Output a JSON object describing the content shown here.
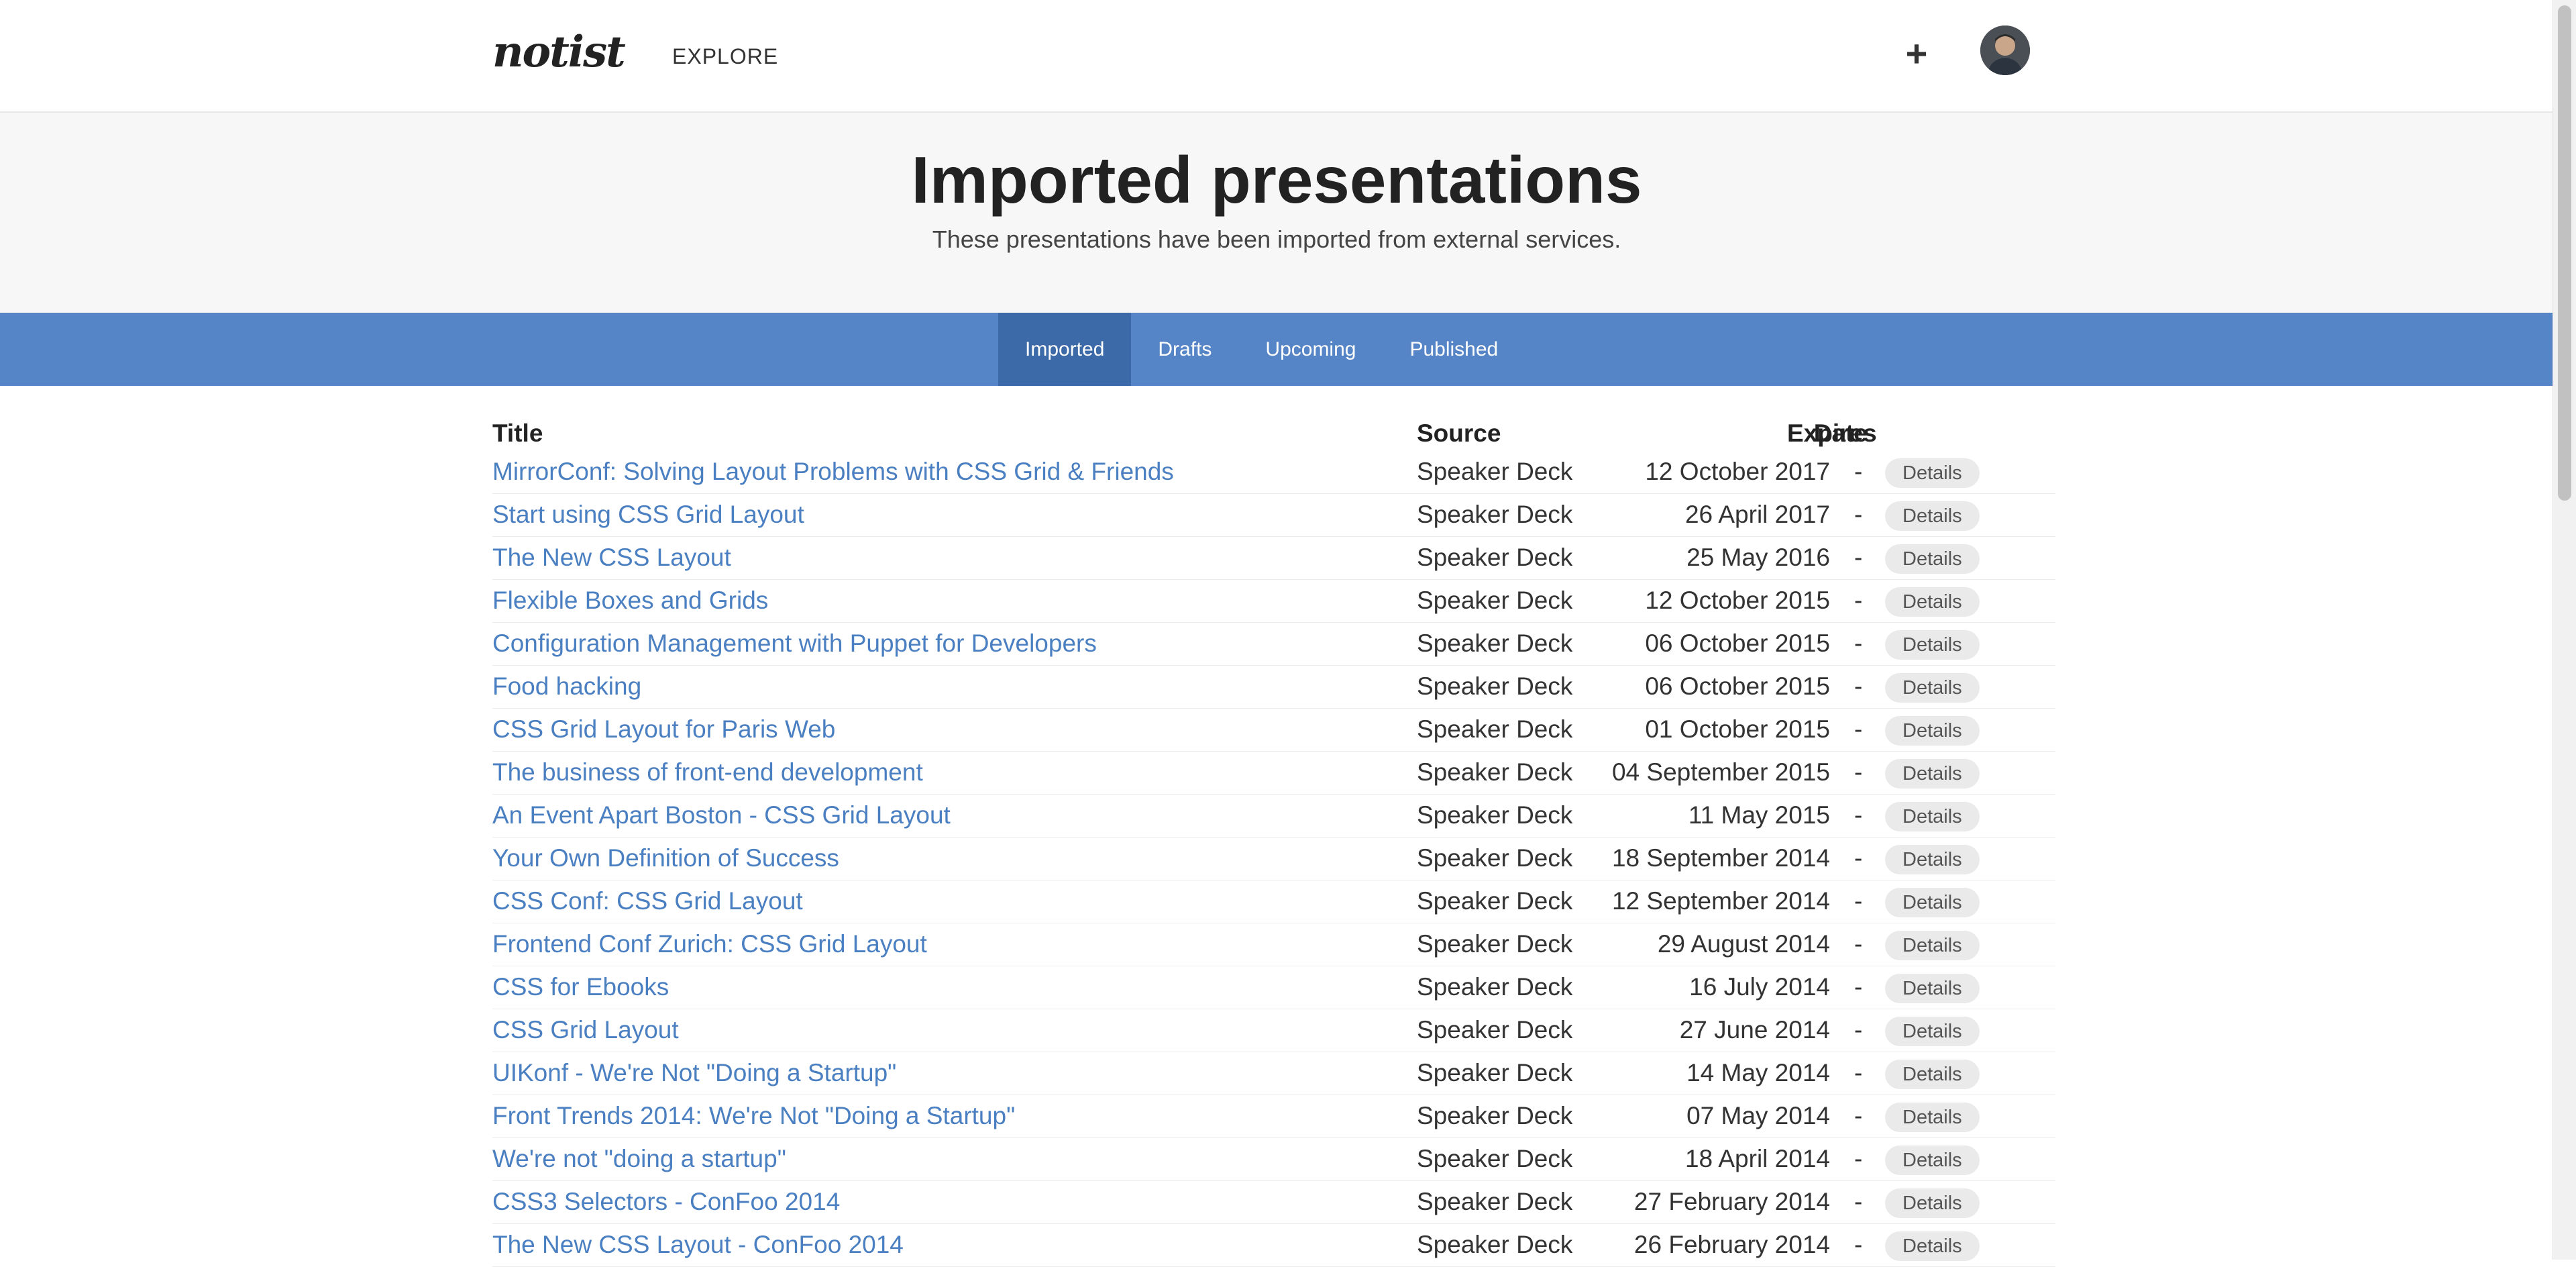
{
  "nav": {
    "logo": "notist",
    "explore_label": "EXPLORE",
    "add_label": "+"
  },
  "hero": {
    "title": "Imported presentations",
    "subtitle": "These presentations have been imported from external services."
  },
  "tabs": [
    {
      "label": "Imported",
      "active": true
    },
    {
      "label": "Drafts",
      "active": false
    },
    {
      "label": "Upcoming",
      "active": false
    },
    {
      "label": "Published",
      "active": false
    }
  ],
  "table": {
    "headers": {
      "title": "Title",
      "source": "Source",
      "date": "Date",
      "expires": "Expires"
    },
    "details_label": "Details",
    "rows": [
      {
        "title": "MirrorConf: Solving Layout Problems with CSS Grid & Friends",
        "source": "Speaker Deck",
        "date": "12 October 2017",
        "expires": "-"
      },
      {
        "title": "Start using CSS Grid Layout",
        "source": "Speaker Deck",
        "date": "26 April 2017",
        "expires": "-"
      },
      {
        "title": "The New CSS Layout",
        "source": "Speaker Deck",
        "date": "25 May 2016",
        "expires": "-"
      },
      {
        "title": "Flexible Boxes and Grids",
        "source": "Speaker Deck",
        "date": "12 October 2015",
        "expires": "-"
      },
      {
        "title": "Configuration Management with Puppet for Developers",
        "source": "Speaker Deck",
        "date": "06 October 2015",
        "expires": "-"
      },
      {
        "title": "Food hacking",
        "source": "Speaker Deck",
        "date": "06 October 2015",
        "expires": "-"
      },
      {
        "title": "CSS Grid Layout for Paris Web",
        "source": "Speaker Deck",
        "date": "01 October 2015",
        "expires": "-"
      },
      {
        "title": "The business of front-end development",
        "source": "Speaker Deck",
        "date": "04 September 2015",
        "expires": "-"
      },
      {
        "title": "An Event Apart Boston - CSS Grid Layout",
        "source": "Speaker Deck",
        "date": "11 May 2015",
        "expires": "-"
      },
      {
        "title": "Your Own Definition of Success",
        "source": "Speaker Deck",
        "date": "18 September 2014",
        "expires": "-"
      },
      {
        "title": "CSS Conf: CSS Grid Layout",
        "source": "Speaker Deck",
        "date": "12 September 2014",
        "expires": "-"
      },
      {
        "title": "Frontend Conf Zurich: CSS Grid Layout",
        "source": "Speaker Deck",
        "date": "29 August 2014",
        "expires": "-"
      },
      {
        "title": "CSS for Ebooks",
        "source": "Speaker Deck",
        "date": "16 July 2014",
        "expires": "-"
      },
      {
        "title": "CSS Grid Layout",
        "source": "Speaker Deck",
        "date": "27 June 2014",
        "expires": "-"
      },
      {
        "title": "UIKonf - We're Not \"Doing a Startup\"",
        "source": "Speaker Deck",
        "date": "14 May 2014",
        "expires": "-"
      },
      {
        "title": "Front Trends 2014: We're Not \"Doing a Startup\"",
        "source": "Speaker Deck",
        "date": "07 May 2014",
        "expires": "-"
      },
      {
        "title": "We're not \"doing a startup\"",
        "source": "Speaker Deck",
        "date": "18 April 2014",
        "expires": "-"
      },
      {
        "title": "CSS3 Selectors - ConFoo 2014",
        "source": "Speaker Deck",
        "date": "27 February 2014",
        "expires": "-"
      },
      {
        "title": "The New CSS Layout - ConFoo 2014",
        "source": "Speaker Deck",
        "date": "26 February 2014",
        "expires": "-"
      }
    ]
  },
  "colors": {
    "link": "#4a7fc1",
    "tabbar": "#5585c6",
    "tab_active": "#3c6aa8",
    "hero_bg": "#f7f7f7"
  }
}
